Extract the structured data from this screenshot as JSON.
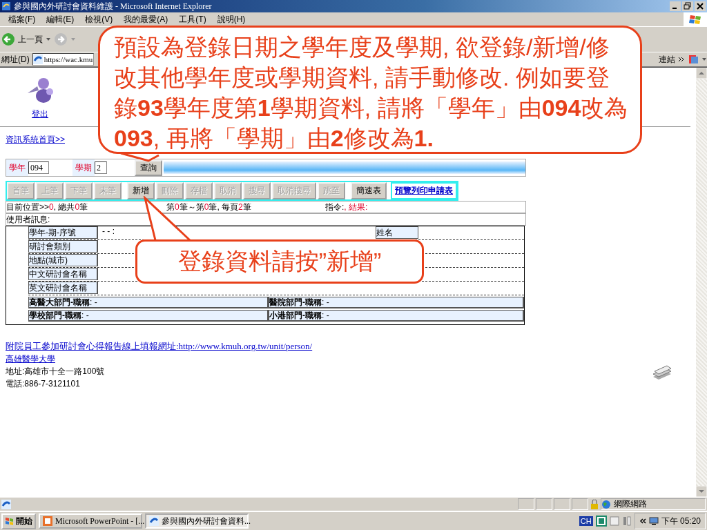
{
  "window": {
    "title": "參與國內外研討會資料維護 - Microsoft Internet Explorer"
  },
  "menu": [
    "檔案(F)",
    "編輯(E)",
    "檢視(V)",
    "我的最愛(A)",
    "工具(T)",
    "說明(H)"
  ],
  "toolbar": {
    "back": "上一頁"
  },
  "address_bar": {
    "label": "網址(D)",
    "url": "https://wac.kmu",
    "links": "連結"
  },
  "page": {
    "logout": "登出",
    "breadcrumb": "資訊系統首頁>>",
    "query": {
      "year_label": "學年",
      "year_value": "094",
      "term_label": "學期",
      "term_value": "2",
      "button": "查詢"
    },
    "actions": [
      {
        "label": "首筆",
        "disabled": true
      },
      {
        "label": "上筆",
        "disabled": true
      },
      {
        "label": "下筆",
        "disabled": true
      },
      {
        "label": "末筆",
        "disabled": true
      },
      {
        "label": "新增",
        "disabled": false
      },
      {
        "label": "刪除",
        "disabled": true
      },
      {
        "label": "存檔",
        "disabled": true
      },
      {
        "label": "取消",
        "disabled": true
      },
      {
        "label": "搜尋",
        "disabled": true
      },
      {
        "label": "取消搜尋",
        "disabled": true
      },
      {
        "label": "跳至",
        "disabled": true
      },
      {
        "label": "簡速表",
        "disabled": false
      }
    ],
    "print_link": "預覽列印申請表",
    "status": [
      [
        {
          "text": "目前位置>>",
          "emphasis": false
        },
        {
          "text": "0",
          "emphasis": true
        },
        {
          "text": ", 總共",
          "emphasis": false
        },
        {
          "text": "0",
          "emphasis": true
        },
        {
          "text": "筆",
          "emphasis": false
        }
      ],
      [
        {
          "text": "第",
          "emphasis": false
        },
        {
          "text": "0",
          "emphasis": true
        },
        {
          "text": "筆～第",
          "emphasis": false
        },
        {
          "text": "0",
          "emphasis": true
        },
        {
          "text": "筆, 每頁",
          "emphasis": false
        },
        {
          "text": "2",
          "emphasis": true
        },
        {
          "text": "筆",
          "emphasis": false
        }
      ],
      [
        {
          "text": "指令:",
          "emphasis": false
        },
        {
          "text": ", 結果:",
          "emphasis": true
        }
      ]
    ],
    "user_message": "使用者訊息:",
    "fields": [
      {
        "label": "學年-期-序號",
        "value": "- - :"
      },
      {
        "label": "研討會類別"
      },
      {
        "label": "地點(城市)"
      },
      {
        "label": "中文研討會名稱"
      },
      {
        "label": "英文研討會名稱"
      }
    ],
    "name_label": "姓名",
    "departments": [
      {
        "label": "高醫大部門-職稱",
        "value": ": -"
      },
      {
        "label": "醫院部門-職稱",
        "value": ": -"
      },
      {
        "label": "學校部門-職稱",
        "value": ": -"
      },
      {
        "label": "小港部門-職稱",
        "value": ": -"
      }
    ],
    "footer": {
      "report_link": "附院員工參加研討會心得報告線上填報網址:http://www.kmuh.org.tw/unit/person/",
      "school_link": "高雄醫學大學",
      "address": "地址:高雄市十全一路100號",
      "phone": "電話:886-7-3121101"
    }
  },
  "callouts": [
    {
      "text": "預設為登錄日期之學年度及學期, 欲登錄/新增/修改其他學年度或學期資料, 請手動修改. 例如要登錄**93**學年度第**1**學期資料, 請將「學年」由**094**改為**093**, 再將「學期」由**2**修改為**1.**"
    },
    {
      "text": "登錄資料請按”新增”"
    }
  ],
  "status_bar": {
    "zone": "網際網路"
  },
  "taskbar": {
    "start": "開始",
    "tasks": [
      {
        "label": "Microsoft PowerPoint - [...",
        "selected": false
      },
      {
        "label": "參與國內外研討會資料...",
        "selected": true
      }
    ],
    "ime": "CH",
    "clock": "下午 05:20"
  }
}
